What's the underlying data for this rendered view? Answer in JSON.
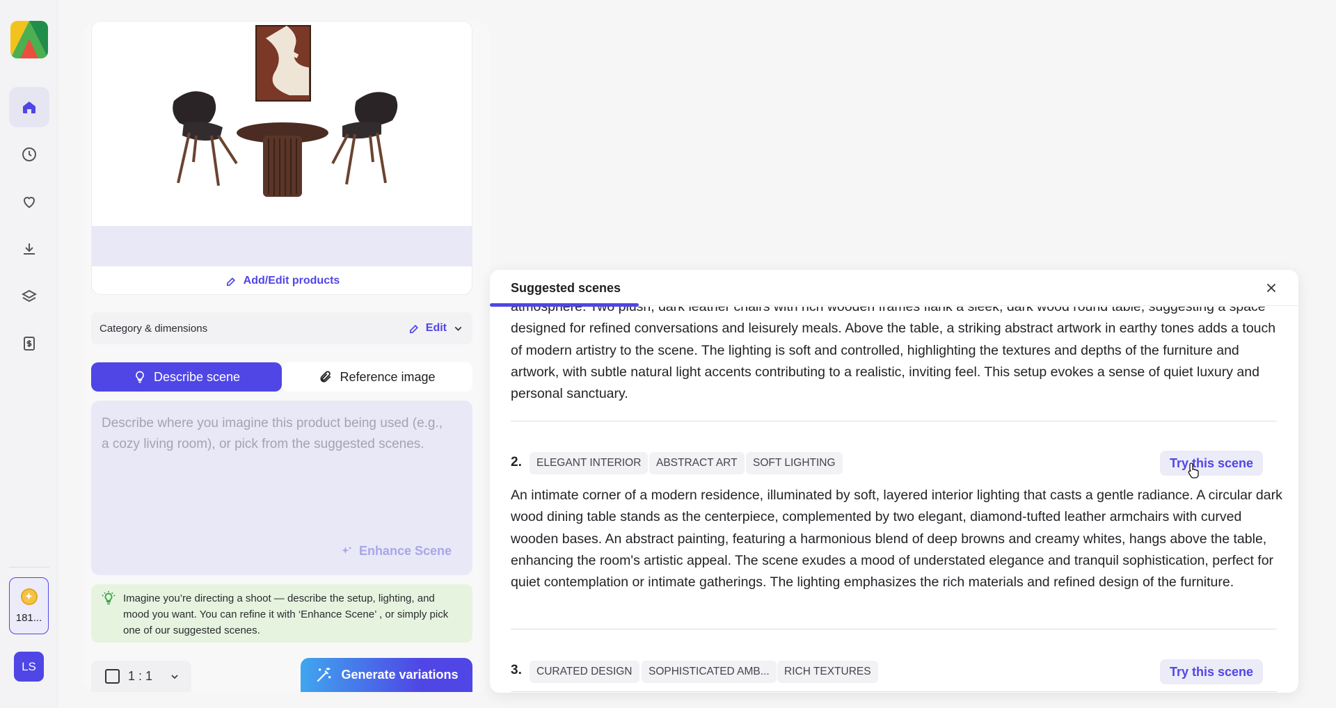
{
  "sidebar": {
    "credits_count": "181...",
    "avatar_initials": "LS"
  },
  "product_card": {
    "add_edit_label": "Add/Edit products"
  },
  "category": {
    "label": "Category & dimensions",
    "edit_label": "Edit"
  },
  "tabs": [
    {
      "label": "Describe scene"
    },
    {
      "label": "Reference image"
    }
  ],
  "describe": {
    "placeholder": "Describe where you imagine this product being used (e.g., a cozy living room), or pick from the suggested scenes.",
    "enhance_label": "Enhance Scene"
  },
  "tip": {
    "text": "Imagine you’re directing a shoot — describe the setup, lighting, and mood you want. You can refine it with ‘Enhance Scene’ , or simply pick one of our suggested scenes."
  },
  "footer": {
    "ratio": "1 : 1",
    "generate_label": "Generate variations"
  },
  "modal": {
    "title": "Suggested scenes",
    "scenes": [
      {
        "text": "atmosphere. Two plush, dark leather chairs with rich wooden frames flank a sleek, dark wood round table, suggesting a space designed for refined conversations and leisurely meals. Above the table, a striking abstract artwork in earthy tones adds a touch of modern artistry to the scene. The lighting is soft and controlled, highlighting the textures and depths of the furniture and artwork, with subtle natural light accents contributing to a realistic, inviting feel. This setup evokes a sense of quiet luxury and personal sanctuary."
      },
      {
        "number": "2.",
        "tags": [
          "ELEGANT INTERIOR",
          "ABSTRACT ART",
          "SOFT LIGHTING"
        ],
        "try_label": "Try this scene",
        "text": "An intimate corner of a modern residence, illuminated by soft, layered interior lighting that casts a gentle radiance. A circular dark wood dining table stands as the centerpiece, complemented by two elegant, diamond-tufted leather armchairs with curved wooden bases. An abstract painting, featuring a harmonious blend of deep browns and creamy whites, hangs above the table, enhancing the room's artistic appeal. The scene exudes a mood of understated elegance and tranquil sophistication, perfect for quiet contemplation or intimate gatherings. The lighting emphasizes the rich materials and refined design of the furniture."
      },
      {
        "number": "3.",
        "tags": [
          "CURATED DESIGN",
          "SOPHISTICATED AMB...",
          "RICH TEXTURES"
        ],
        "try_label": "Try this scene"
      }
    ]
  },
  "colors": {
    "accent": "#4f46e5",
    "tip_bg": "#e6f4df",
    "input_bg": "#e8e8f7"
  }
}
